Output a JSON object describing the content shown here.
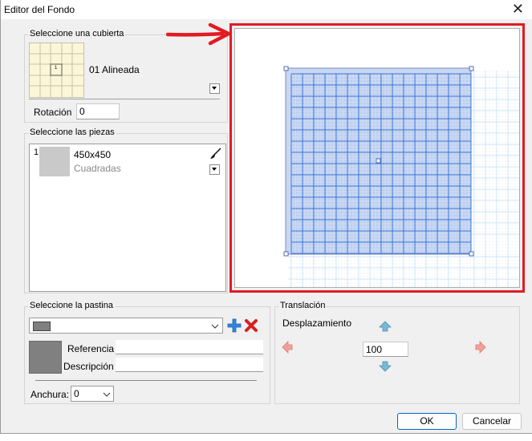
{
  "window": {
    "title": "Editor del Fondo",
    "close_glyph": "✕"
  },
  "cubierta": {
    "group_label": "Seleccione una cubierta",
    "thumbnail_label": "1",
    "name": "01 Alineada",
    "rotation_label": "Rotación",
    "rotation_value": "0"
  },
  "piezas": {
    "group_label": "Seleccione las piezas",
    "items": [
      {
        "index": "1",
        "size": "450x450",
        "type": "Cuadradas"
      }
    ]
  },
  "pastina": {
    "group_label": "Seleccione la pastina",
    "referencia_label": "Referencia",
    "descripcion_label": "Descripción",
    "referencia_value": "",
    "descripcion_value": "",
    "anchura_label": "Anchura:",
    "anchura_value": "0",
    "swatch_color": "#808080"
  },
  "traslacion": {
    "group_label": "Translación",
    "desplazamiento_label": "Desplazamiento",
    "value": "100"
  },
  "buttons": {
    "ok": "OK",
    "cancel": "Cancelar"
  },
  "colors": {
    "annotation_red": "#e21b23",
    "tile_blue": "#3d7ad9",
    "selection_fill": "#c9d7f3",
    "arrow_up": "#7ab8d6",
    "arrow_side": "#f2a19a"
  }
}
